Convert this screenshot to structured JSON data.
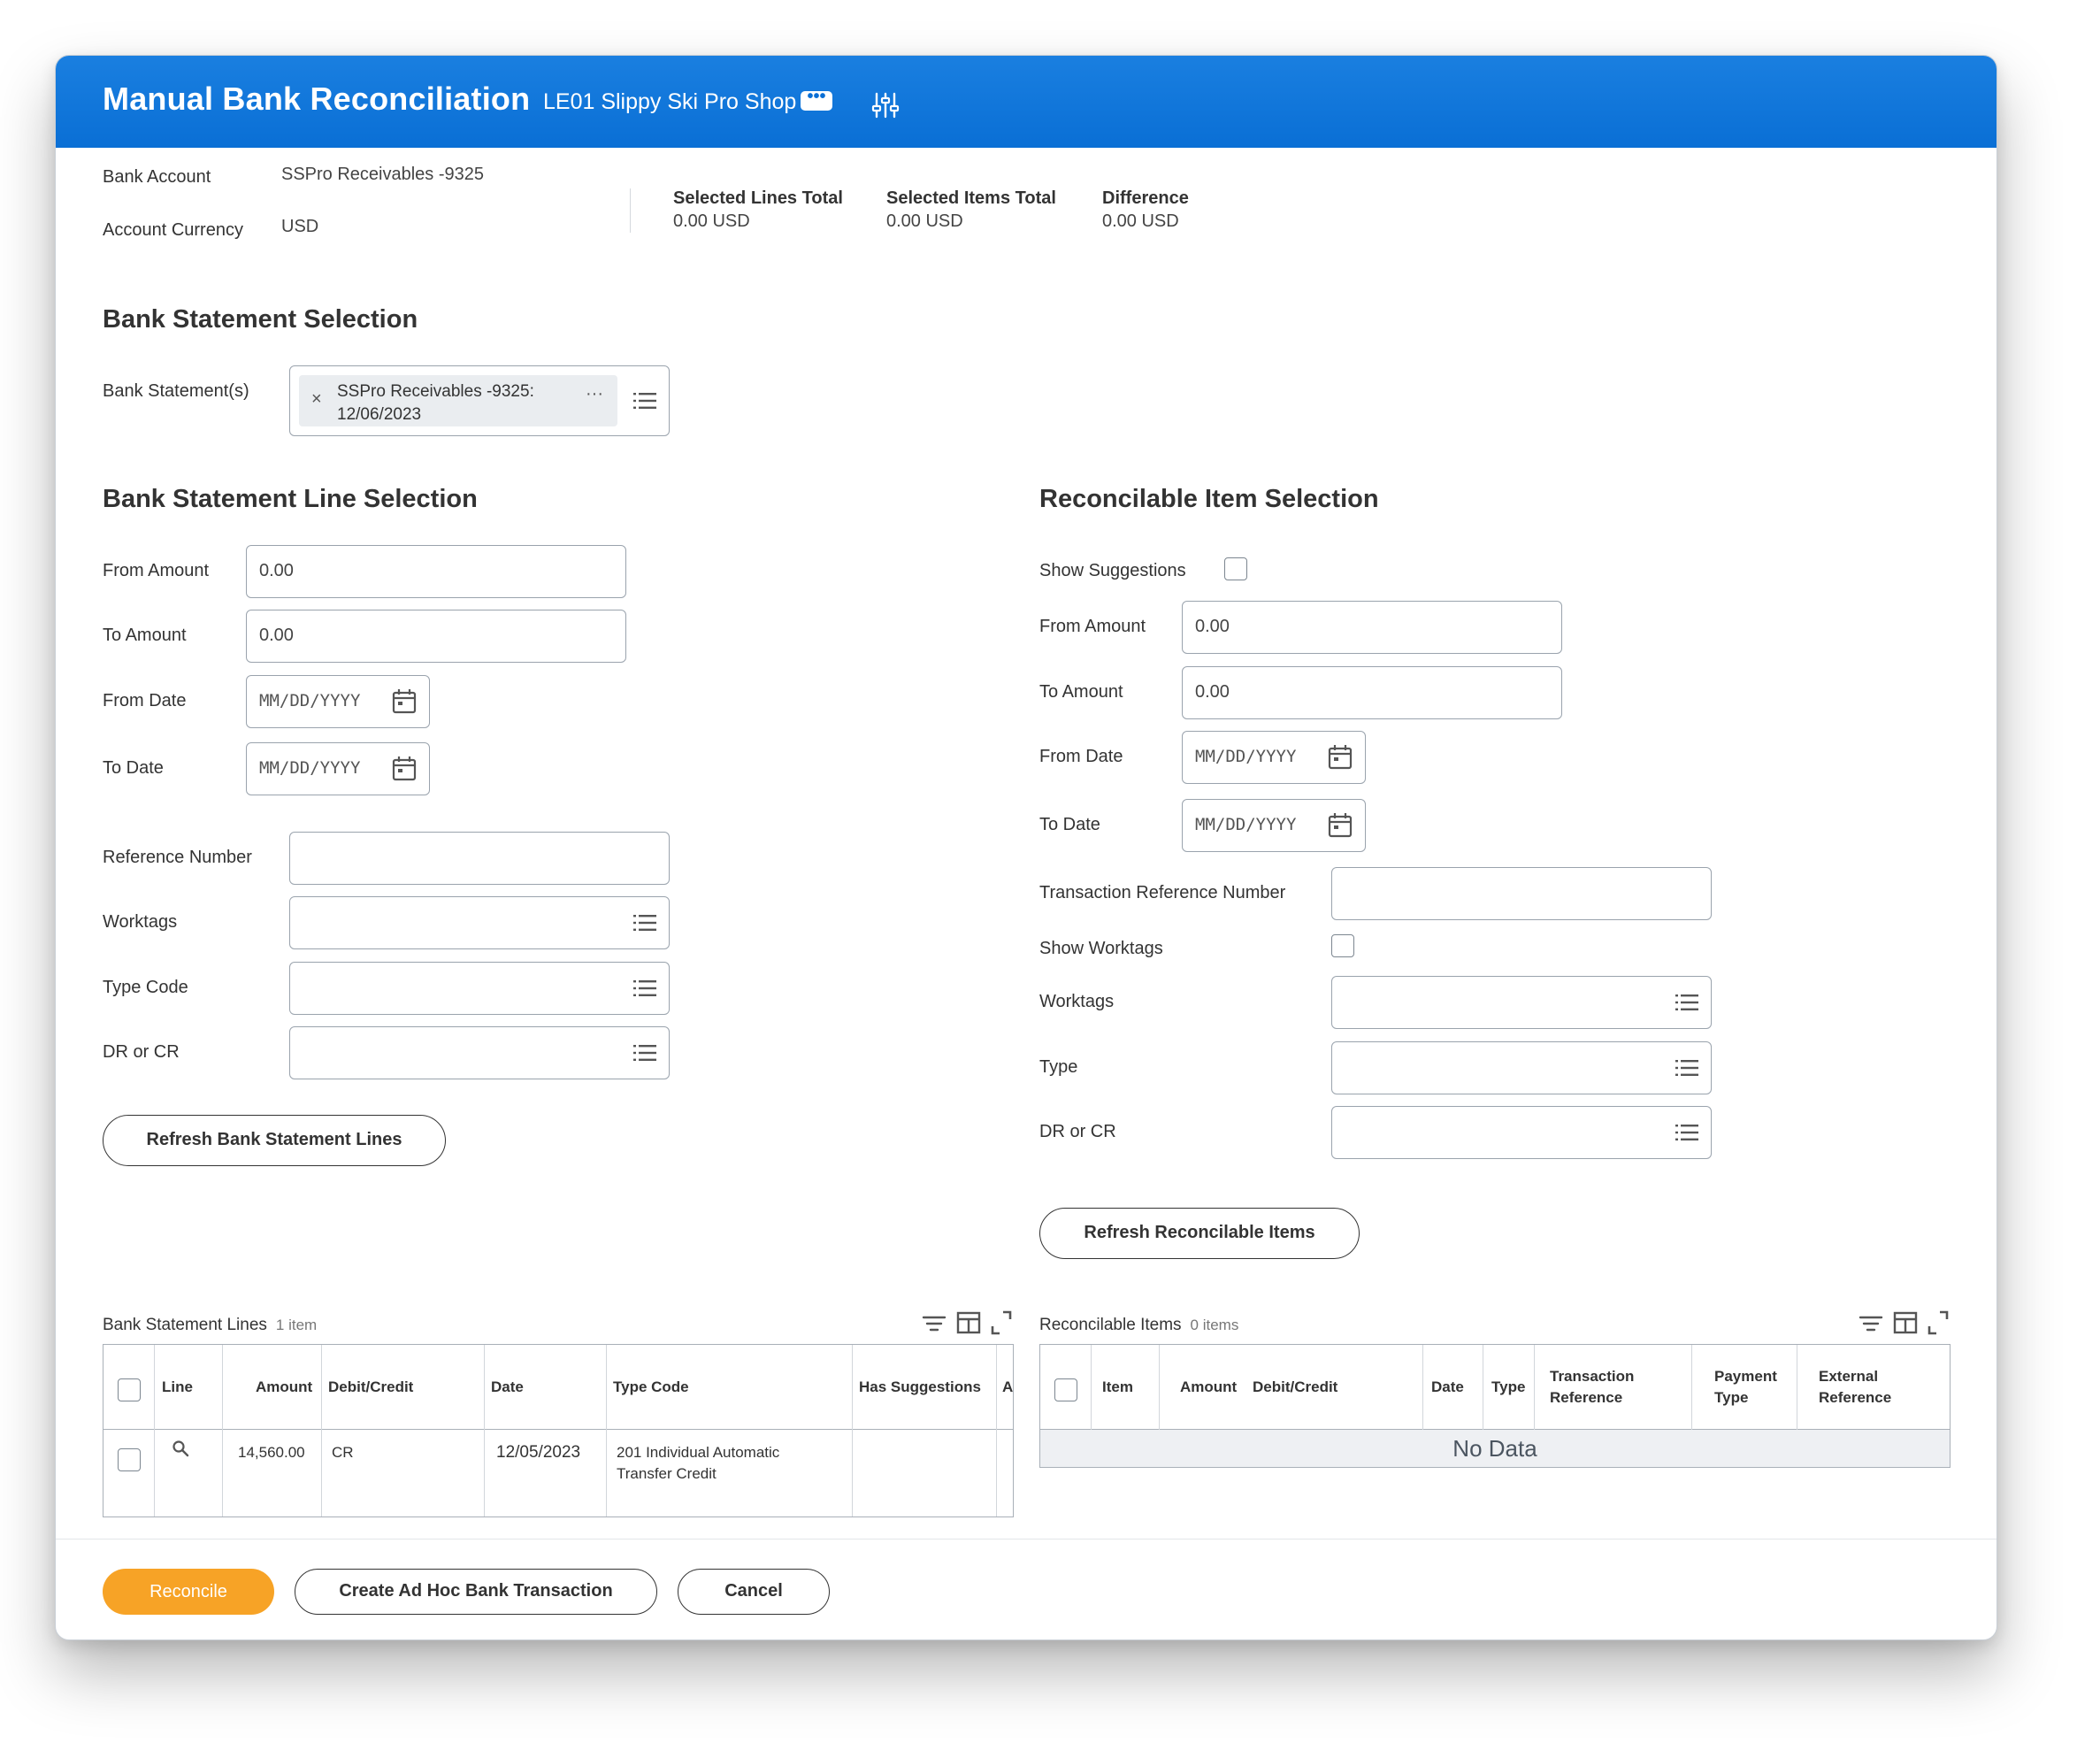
{
  "header": {
    "title": "Manual Bank Reconciliation",
    "organization": "LE01 Slippy Ski Pro Shop",
    "more_label": "•••"
  },
  "account": {
    "bank_account_label": "Bank Account",
    "bank_account_value": "SSPro Receivables -9325",
    "currency_label": "Account Currency",
    "currency_value": "USD"
  },
  "totals": {
    "selected_lines_label": "Selected Lines Total",
    "selected_lines_value": "0.00 USD",
    "selected_items_label": "Selected Items Total",
    "selected_items_value": "0.00 USD",
    "difference_label": "Difference",
    "difference_value": "0.00 USD"
  },
  "statement_selection": {
    "title": "Bank Statement Selection",
    "label": "Bank Statement(s)",
    "chip_remove": "×",
    "chip_line1": "SSPro Receivables -9325:",
    "chip_line2": "12/06/2023",
    "chip_more": "···"
  },
  "line_selection": {
    "title": "Bank Statement Line Selection",
    "from_amount_label": "From Amount",
    "from_amount_value": "0.00",
    "to_amount_label": "To Amount",
    "to_amount_value": "0.00",
    "from_date_label": "From Date",
    "to_date_label": "To Date",
    "date_placeholder": "MM/DD/YYYY",
    "reference_label": "Reference Number",
    "worktags_label": "Worktags",
    "type_code_label": "Type Code",
    "drcr_label": "DR or CR",
    "refresh_button": "Refresh Bank Statement Lines"
  },
  "item_selection": {
    "title": "Reconcilable Item Selection",
    "show_suggestions_label": "Show Suggestions",
    "from_amount_label": "From Amount",
    "from_amount_value": "0.00",
    "to_amount_label": "To Amount",
    "to_amount_value": "0.00",
    "from_date_label": "From Date",
    "to_date_label": "To Date",
    "date_placeholder": "MM/DD/YYYY",
    "txn_reference_label": "Transaction Reference Number",
    "show_worktags_label": "Show Worktags",
    "worktags_label": "Worktags",
    "type_label": "Type",
    "drcr_label": "DR or CR",
    "refresh_button": "Refresh Reconcilable Items"
  },
  "lines_table": {
    "title": "Bank Statement Lines",
    "count": "1 item",
    "columns": [
      "Line",
      "Amount",
      "Debit/Credit",
      "Date",
      "Type Code",
      "Has Suggestions",
      "A"
    ],
    "rows": [
      {
        "amount": "14,560.00",
        "debit_credit": "CR",
        "date": "12/05/2023",
        "type_code_line1": "201 Individual Automatic",
        "type_code_line2": "Transfer Credit",
        "has_suggestions": ""
      }
    ]
  },
  "items_table": {
    "title": "Reconcilable Items",
    "count": "0 items",
    "columns": {
      "item": "Item",
      "amount": "Amount",
      "debit_credit": "Debit/Credit",
      "date": "Date",
      "type": "Type",
      "txn_ref_1": "Transaction",
      "txn_ref_2": "Reference",
      "pay_type_1": "Payment",
      "pay_type_2": "Type",
      "ext_ref_1": "External",
      "ext_ref_2": "Reference"
    },
    "empty_text": "No Data"
  },
  "footer": {
    "reconcile": "Reconcile",
    "ad_hoc": "Create Ad Hoc Bank Transaction",
    "cancel": "Cancel"
  },
  "colors": {
    "header_blue": "#0a6fd5",
    "primary_orange": "#f7a326",
    "text": "#333333"
  },
  "icons": [
    "related-actions-icon",
    "tune-icon",
    "prompt-list-icon",
    "calendar-icon",
    "filter-icon",
    "columns-icon",
    "expand-icon",
    "search-icon",
    "close-icon"
  ]
}
